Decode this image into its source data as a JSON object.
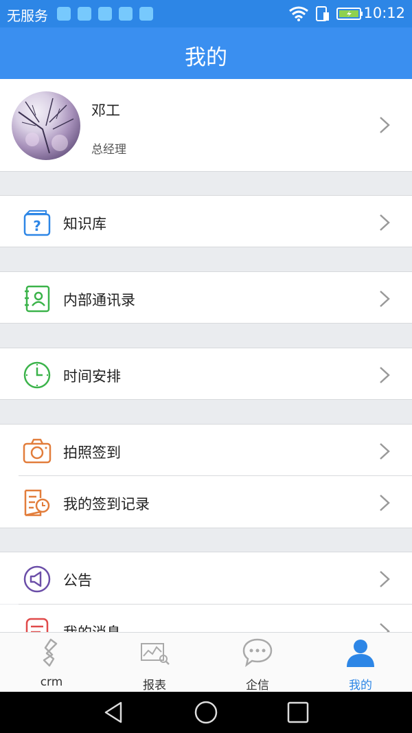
{
  "status_bar": {
    "carrier": "无服务",
    "time": "10:12"
  },
  "title_bar": {
    "title": "我的"
  },
  "profile": {
    "name": "邓工",
    "role": "总经理"
  },
  "menu": [
    {
      "label": "知识库",
      "icon": "knowledge-base-icon",
      "color": "#2d86e6"
    },
    {
      "label": "内部通讯录",
      "icon": "contacts-book-icon",
      "color": "#3bb34a"
    },
    {
      "label": "时间安排",
      "icon": "clock-icon",
      "color": "#3bb34a"
    },
    {
      "label": "拍照签到",
      "icon": "camera-icon",
      "color": "#e27d3b"
    },
    {
      "label": "我的签到记录",
      "icon": "checkin-record-icon",
      "color": "#e27d3b"
    },
    {
      "label": "公告",
      "icon": "announcement-icon",
      "color": "#6b4ea8"
    },
    {
      "label": "我的消息",
      "icon": "message-icon",
      "color": "#e04a4a"
    }
  ],
  "tabs": [
    {
      "label": "crm",
      "icon": "crm-logo-icon"
    },
    {
      "label": "报表",
      "icon": "report-chart-icon"
    },
    {
      "label": "企信",
      "icon": "chat-bubble-icon"
    },
    {
      "label": "我的",
      "icon": "person-icon",
      "active": true
    }
  ],
  "colors": {
    "brand_blue": "#3a8ff0",
    "active_tab": "#2d86e6",
    "background": "#eaecef"
  }
}
